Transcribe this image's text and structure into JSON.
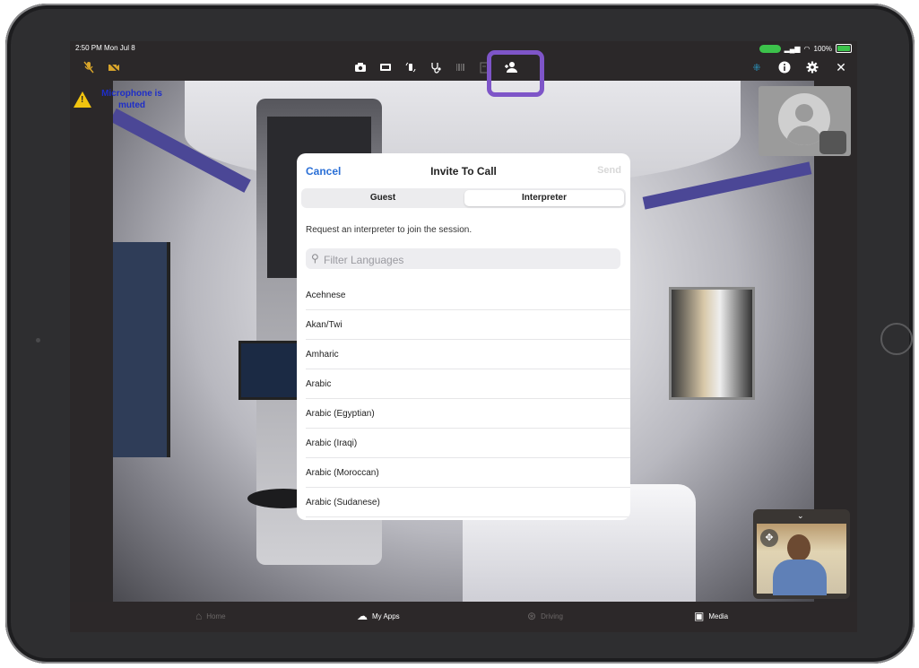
{
  "status_bar": {
    "time": "2:50 PM  Mon Jul 8",
    "battery_pill": "",
    "battery_percent": "100%"
  },
  "toolbar": {
    "left_icons": [
      "microphone-muted-icon",
      "video-muted-icon"
    ],
    "center_icons": [
      "camera-icon",
      "screen-share-icon",
      "rotate-icon",
      "stethoscope-icon",
      "barcode-icon",
      "document-icon",
      "add-person-icon"
    ],
    "right_icons": [
      "layout-icon",
      "info-icon",
      "gear-icon",
      "close-icon"
    ],
    "colors": {
      "muted": "#d7a42b",
      "highlight": "#7e55c8",
      "teal": "#2aa4d5"
    }
  },
  "warning": {
    "icon": "warning-triangle-icon",
    "text": "Microphone is muted"
  },
  "modal": {
    "cancel": "Cancel",
    "title": "Invite To Call",
    "send": "Send",
    "segments": [
      {
        "label": "Guest",
        "active": false
      },
      {
        "label": "Interpreter",
        "active": true
      }
    ],
    "description": "Request an interpreter to join the session.",
    "search_placeholder": "Filter Languages",
    "languages": [
      "Acehnese",
      "Akan/Twi",
      "Amharic",
      "Arabic",
      "Arabic (Egyptian)",
      "Arabic (Iraqi)",
      "Arabic (Moroccan)",
      "Arabic (Sudanese)"
    ]
  },
  "bottom_nav": [
    {
      "label": "Home",
      "icon": "home-icon",
      "dim": true
    },
    {
      "label": "My Apps",
      "icon": "apps-icon",
      "dim": false
    },
    {
      "label": "Driving",
      "icon": "steering-wheel-icon",
      "dim": true
    },
    {
      "label": "Media",
      "icon": "media-icon",
      "dim": false
    }
  ]
}
